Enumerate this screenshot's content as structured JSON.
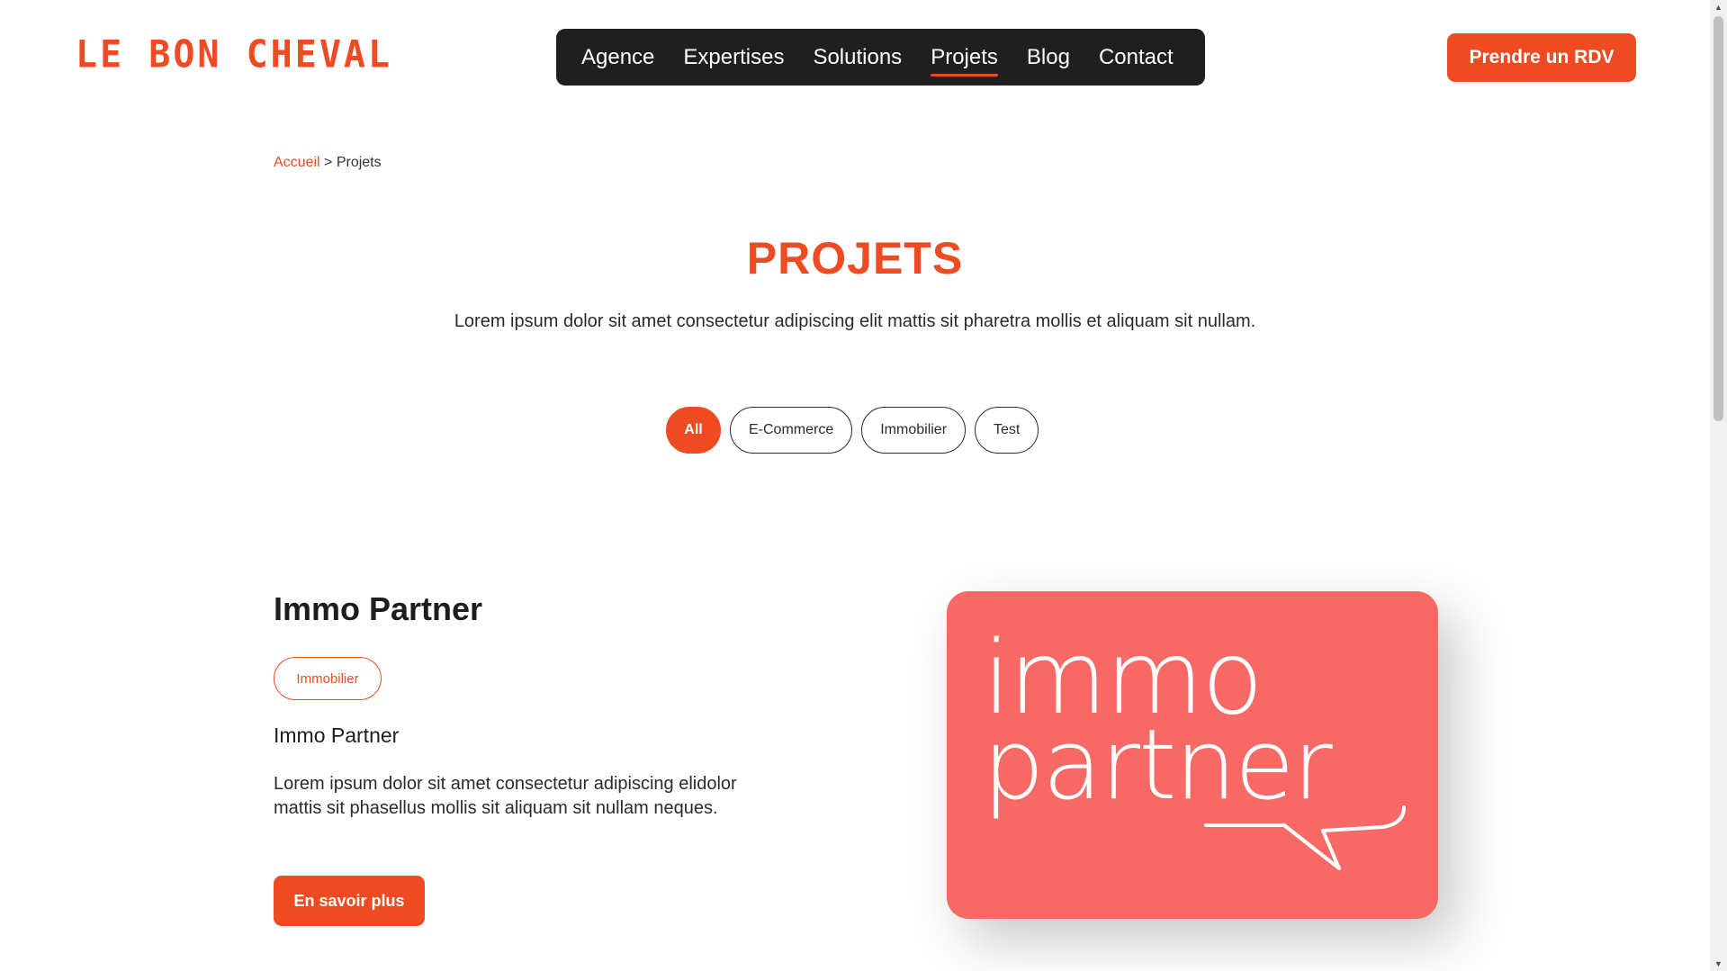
{
  "brand": {
    "logo_text": "LE BON CHEVAL",
    "accent": "#ef4b23"
  },
  "nav": {
    "items": [
      {
        "label": "Agence"
      },
      {
        "label": "Expertises"
      },
      {
        "label": "Solutions"
      },
      {
        "label": "Projets",
        "active": true
      },
      {
        "label": "Blog"
      },
      {
        "label": "Contact"
      }
    ]
  },
  "cta": {
    "label": "Prendre un RDV"
  },
  "breadcrumb": {
    "home": "Accueil",
    "separator": ">",
    "current": "Projets"
  },
  "page": {
    "title": "PROJETS",
    "intro": "Lorem ipsum dolor sit amet consectetur adipiscing elit mattis sit pharetra mollis et aliquam sit nullam."
  },
  "filters": [
    {
      "label": "All",
      "active": true
    },
    {
      "label": "E-Commerce"
    },
    {
      "label": "Immobilier"
    },
    {
      "label": "Test"
    }
  ],
  "project": {
    "title": "Immo Partner",
    "tag": "Immobilier",
    "subtitle": "Immo Partner",
    "description": "Lorem ipsum dolor sit amet consectetur adipiscing elidolor mattis sit phasellus mollis sit aliquam sit nullam neques.",
    "button": "En savoir plus",
    "image": {
      "word1": "immo",
      "word2": "partner",
      "bg": "#f66964"
    }
  }
}
